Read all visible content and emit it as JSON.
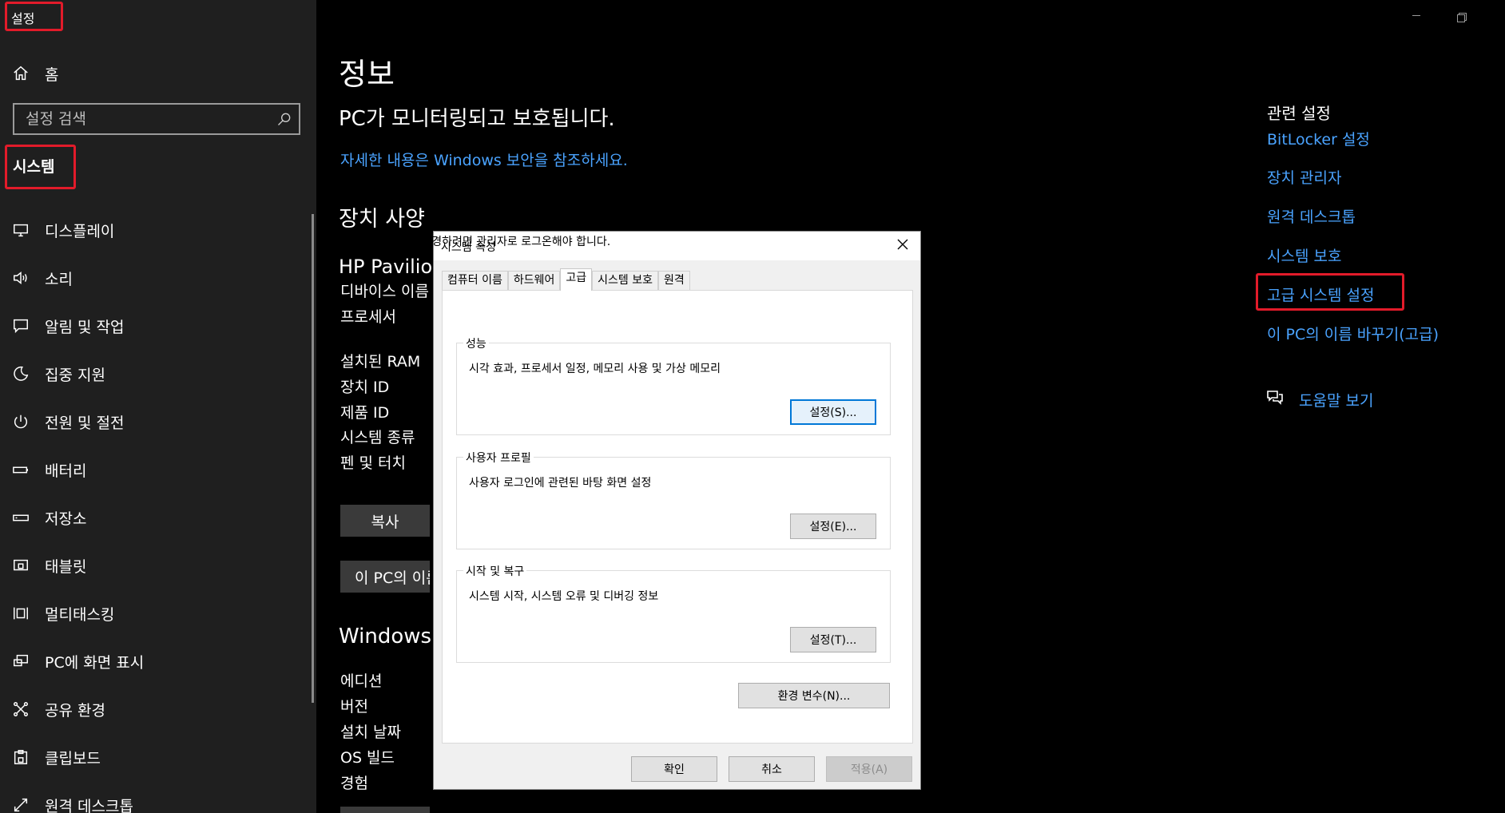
{
  "settings": {
    "app_title": "설정",
    "home_label": "홈",
    "search_placeholder": "설정 검색",
    "section_title": "시스템",
    "nav": [
      {
        "label": "디스플레이",
        "icon": "monitor-icon"
      },
      {
        "label": "소리",
        "icon": "speaker-icon"
      },
      {
        "label": "알림 및 작업",
        "icon": "notification-icon"
      },
      {
        "label": "집중 지원",
        "icon": "moon-icon"
      },
      {
        "label": "전원 및 절전",
        "icon": "power-icon"
      },
      {
        "label": "배터리",
        "icon": "battery-icon"
      },
      {
        "label": "저장소",
        "icon": "storage-icon"
      },
      {
        "label": "태블릿",
        "icon": "tablet-icon"
      },
      {
        "label": "멀티태스킹",
        "icon": "multitasking-icon"
      },
      {
        "label": "PC에 화면 표시",
        "icon": "project-icon"
      },
      {
        "label": "공유 환경",
        "icon": "share-icon"
      },
      {
        "label": "클립보드",
        "icon": "clipboard-icon"
      },
      {
        "label": "원격 데스크톱",
        "icon": "remote-desktop-icon"
      }
    ]
  },
  "main": {
    "title": "정보",
    "protect_text": "PC가 모니터링되고 보호됩니다.",
    "security_link": "자세한 내용은 Windows 보안을 참조하세요.",
    "spec_title": "장치 사양",
    "device_name": "HP Pavilion",
    "spec_labels": [
      "디바이스 이름",
      "프로세서",
      "설치된 RAM",
      "장치 ID",
      "제품 ID",
      "시스템 종류",
      "펜 및 터치"
    ],
    "copy_button": "복사",
    "rename_button": "이 PC의 이름",
    "windows_spec_title": "Windows",
    "windows_labels": [
      "에디션",
      "버전",
      "설치 날짜",
      "OS 빌드",
      "경험"
    ]
  },
  "related": {
    "title": "관련 설정",
    "links": [
      "BitLocker 설정",
      "장치 관리자",
      "원격 데스크톱",
      "시스템 보호",
      "고급 시스템 설정",
      "이 PC의 이름 바꾸기(고급)"
    ],
    "help_label": "도움말 보기"
  },
  "dialog": {
    "title": "시스템 속성",
    "tabs": [
      "컴퓨터 이름",
      "하드웨어",
      "고급",
      "시스템 보호",
      "원격"
    ],
    "active_tab": "고급",
    "admin_note": "이 내용을 변경하려면 관리자로 로그온해야 합니다.",
    "groups": [
      {
        "label": "성능",
        "desc": "시각 효과, 프로세서 일정, 메모리 사용 및 가상 메모리",
        "button": "설정(S)..."
      },
      {
        "label": "사용자 프로필",
        "desc": "사용자 로그인에 관련된 바탕 화면 설정",
        "button": "설정(E)..."
      },
      {
        "label": "시작 및 복구",
        "desc": "시스템 시작, 시스템 오류 및 디버깅 정보",
        "button": "설정(T)..."
      }
    ],
    "env_button": "환경 변수(N)...",
    "ok_button": "확인",
    "cancel_button": "취소",
    "apply_button": "적용(A)"
  },
  "colors": {
    "sidebar_bg": "#1f1f1f",
    "link": "#4aa3ff",
    "highlight": "#e21b2a",
    "focus": "#0078d7"
  }
}
